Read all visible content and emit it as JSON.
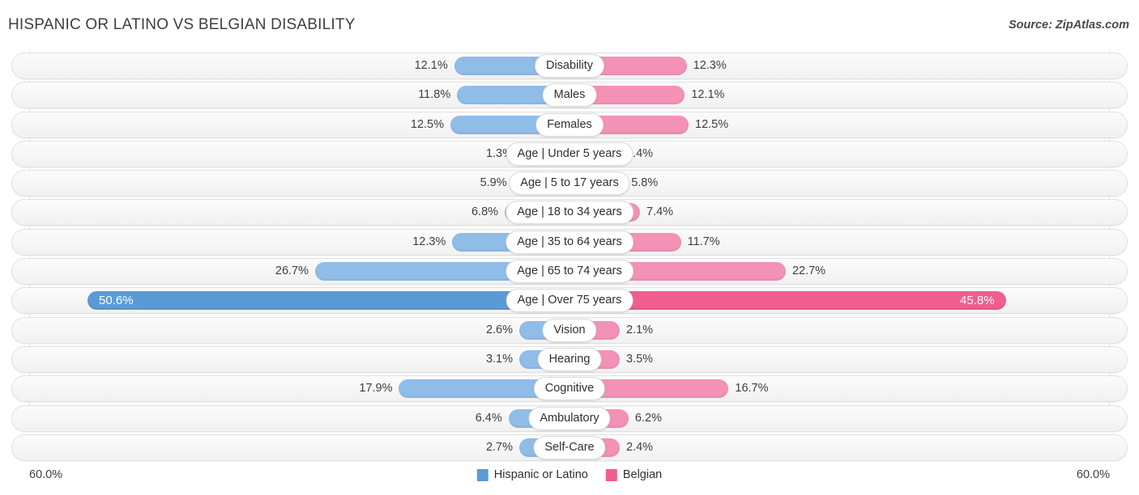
{
  "header": {
    "title": "Hispanic or Latino vs Belgian Disability",
    "source": "Source: ZipAtlas.com"
  },
  "axis": {
    "left_label": "60.0%",
    "right_label": "60.0%"
  },
  "legend": {
    "items": [
      {
        "label": "Hispanic or Latino",
        "color": "#5b9bd5"
      },
      {
        "label": "Belgian",
        "color": "#ef5e8d"
      }
    ]
  },
  "chart_data": {
    "type": "bar",
    "title": "Hispanic or Latino vs Belgian Disability",
    "subtitle": "Source: ZipAtlas.com",
    "orientation": "horizontal-diverging",
    "xlabel": "",
    "ylabel": "",
    "xlim": [
      60.0,
      60.0
    ],
    "unit": "%",
    "grid": true,
    "legend_position": "bottom-center",
    "categories": [
      "Disability",
      "Males",
      "Females",
      "Age | Under 5 years",
      "Age | 5 to 17 years",
      "Age | 18 to 34 years",
      "Age | 35 to 64 years",
      "Age | 65 to 74 years",
      "Age | Over 75 years",
      "Vision",
      "Hearing",
      "Cognitive",
      "Ambulatory",
      "Self-Care"
    ],
    "series": [
      {
        "name": "Hispanic or Latino",
        "color": "#5b9bd5",
        "values": [
          12.1,
          11.8,
          12.5,
          1.3,
          5.9,
          6.8,
          12.3,
          26.7,
          50.6,
          2.6,
          3.1,
          17.9,
          6.4,
          2.7
        ]
      },
      {
        "name": "Belgian",
        "color": "#ef5e8d",
        "values": [
          12.3,
          12.1,
          12.5,
          1.4,
          5.8,
          7.4,
          11.7,
          22.7,
          45.8,
          2.1,
          3.5,
          16.7,
          6.2,
          2.4
        ]
      }
    ],
    "value_labels": {
      "Hispanic or Latino": [
        "12.1%",
        "11.8%",
        "12.5%",
        "1.3%",
        "5.9%",
        "6.8%",
        "12.3%",
        "26.7%",
        "50.6%",
        "2.6%",
        "3.1%",
        "17.9%",
        "6.4%",
        "2.7%"
      ],
      "Belgian": [
        "12.3%",
        "12.1%",
        "12.5%",
        "1.4%",
        "5.8%",
        "7.4%",
        "11.7%",
        "22.7%",
        "45.8%",
        "2.1%",
        "3.5%",
        "16.7%",
        "6.2%",
        "2.4%"
      ]
    },
    "highlighted_row": "Age | Over 75 years"
  }
}
